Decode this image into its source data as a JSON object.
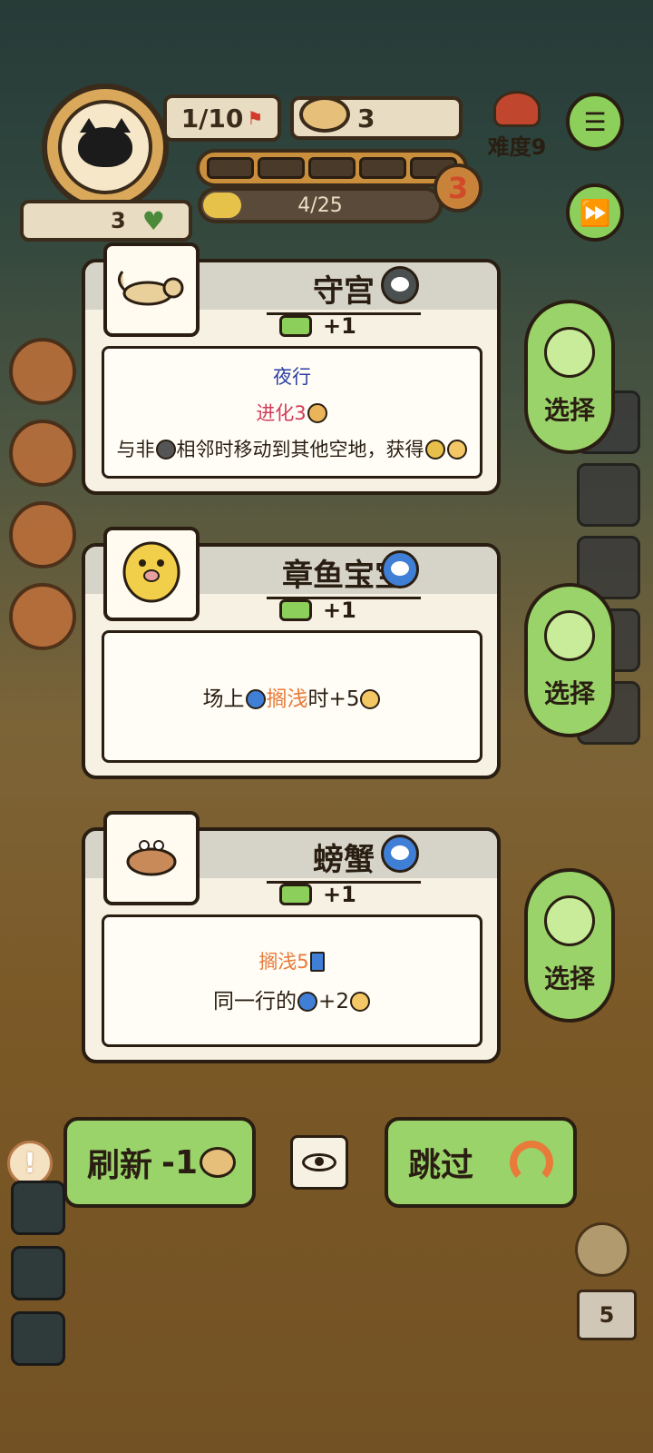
{
  "hud": {
    "wave": "1/10",
    "coins": "3",
    "progress": "4/25",
    "progress_fraction": 0.16,
    "level": "3",
    "hp": "3",
    "difficulty": "难度9"
  },
  "cards": [
    {
      "name": "守宫",
      "cost": "+1",
      "tag_color": "#4a4f4f",
      "lines": {
        "l1": "夜行",
        "l2": "进化3",
        "l3a": "与非",
        "l3b": "相邻时移动到其他空地，获得"
      }
    },
    {
      "name": "章鱼宝宝",
      "cost": "+1",
      "tag_color": "#3f7fd6",
      "lines": {
        "a": "场上",
        "b": "搁浅",
        "c": "时+5"
      }
    },
    {
      "name": "螃蟹",
      "cost": "+1",
      "tag_color": "#3f7fd6",
      "lines": {
        "l1": "搁浅5",
        "l2a": "同一行的",
        "l2b": "+2"
      }
    }
  ],
  "select_label": "选择",
  "bottom": {
    "refresh_label": "刷新",
    "refresh_cost": "-1",
    "skip_label": "跳过",
    "alert": "!",
    "deck_count": "5"
  },
  "icons": {
    "avatar": "black-cat-icon",
    "menu": "menu-icon",
    "fast_forward": "fast-forward-icon",
    "eye": "eye-icon",
    "skip": "undo-arrow-icon"
  }
}
